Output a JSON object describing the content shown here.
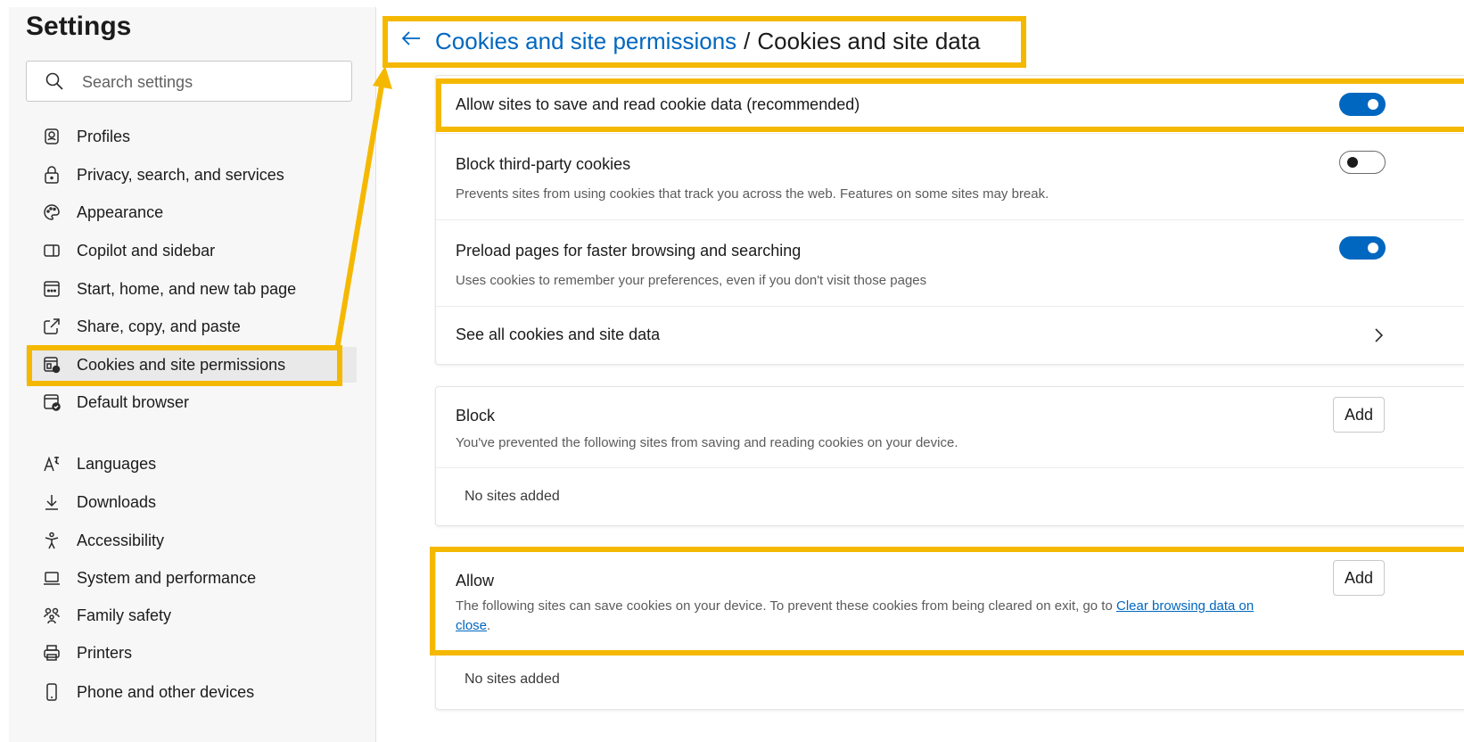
{
  "sidebar": {
    "title": "Settings",
    "search_placeholder": "Search settings",
    "items": [
      {
        "label": "Profiles",
        "icon": "profile-icon"
      },
      {
        "label": "Privacy, search, and services",
        "icon": "lock-icon"
      },
      {
        "label": "Appearance",
        "icon": "palette-icon"
      },
      {
        "label": "Copilot and sidebar",
        "icon": "sidebar-icon"
      },
      {
        "label": "Start, home, and new tab page",
        "icon": "home-tab-icon"
      },
      {
        "label": "Share, copy, and paste",
        "icon": "share-icon"
      },
      {
        "label": "Cookies and site permissions",
        "icon": "cookie-permissions-icon",
        "active": true
      },
      {
        "label": "Default browser",
        "icon": "default-browser-icon"
      },
      {
        "label": "Languages",
        "icon": "languages-icon"
      },
      {
        "label": "Downloads",
        "icon": "download-icon"
      },
      {
        "label": "Accessibility",
        "icon": "accessibility-icon"
      },
      {
        "label": "System and performance",
        "icon": "laptop-icon"
      },
      {
        "label": "Family safety",
        "icon": "family-icon"
      },
      {
        "label": "Printers",
        "icon": "printer-icon"
      },
      {
        "label": "Phone and other devices",
        "icon": "phone-icon"
      }
    ]
  },
  "header": {
    "breadcrumb_link": "Cookies and site permissions",
    "separator": "/",
    "current": "Cookies and site data"
  },
  "settings": {
    "allow_cookies": {
      "label": "Allow sites to save and read cookie data (recommended)",
      "enabled": true
    },
    "block_third_party": {
      "label": "Block third-party cookies",
      "description": "Prevents sites from using cookies that track you across the web. Features on some sites may break.",
      "enabled": false
    },
    "preload": {
      "label": "Preload pages for faster browsing and searching",
      "description": "Uses cookies to remember your preferences, even if you don't visit those pages",
      "enabled": true
    },
    "see_all": {
      "label": "See all cookies and site data"
    }
  },
  "block_section": {
    "title": "Block",
    "description": "You've prevented the following sites from saving and reading cookies on your device.",
    "add_label": "Add",
    "empty": "No sites added"
  },
  "allow_section": {
    "title": "Allow",
    "description_pre": "The following sites can save cookies on your device. To prevent these cookies from being cleared on exit, go to ",
    "link_line1": "Clear browsing data on",
    "link_line2": "close",
    "description_post": ".",
    "add_label": "Add",
    "empty": "No sites added"
  },
  "colors": {
    "accent": "#0067c0",
    "highlight": "#f5b800"
  }
}
